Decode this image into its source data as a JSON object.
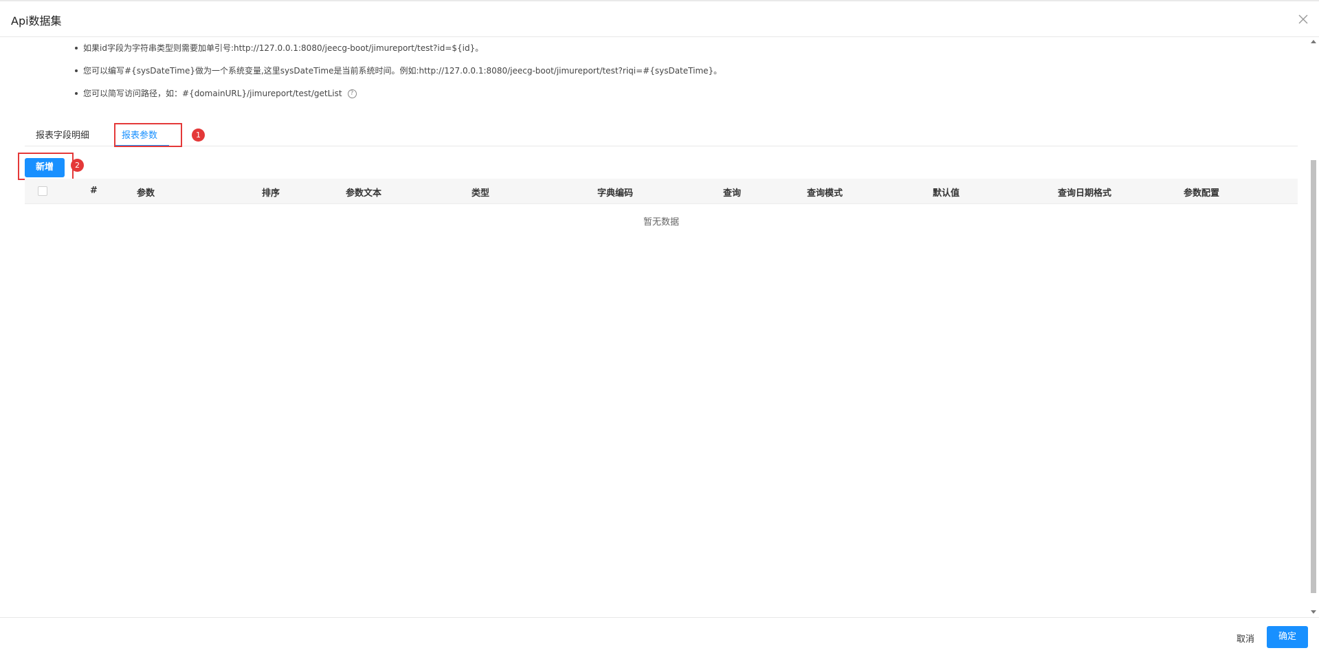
{
  "dialog": {
    "title": "Api数据集"
  },
  "tips": [
    "如果id字段为字符串类型则需要加单引号:http://127.0.0.1:8080/jeecg-boot/jimureport/test?id=${id}。",
    "您可以编写#{sysDateTime}做为一个系统变量,这里sysDateTime是当前系统时间。例如:http://127.0.0.1:8080/jeecg-boot/jimureport/test?riqi=#{sysDateTime}。",
    "您可以简写访问路径，如：#{domainURL}/jimureport/test/getList"
  ],
  "tabs": [
    {
      "label": "报表字段明细"
    },
    {
      "label": "报表参数"
    }
  ],
  "annotations": {
    "badge1": "1",
    "badge2": "2"
  },
  "toolbar": {
    "add_label": "新增"
  },
  "table": {
    "columns": [
      "#",
      "参数",
      "排序",
      "参数文本",
      "类型",
      "字典编码",
      "查询",
      "查询模式",
      "默认值",
      "查询日期格式",
      "参数配置"
    ],
    "empty_text": "暂无数据"
  },
  "footer": {
    "cancel_label": "取消",
    "ok_label": "确定"
  },
  "colors": {
    "primary": "#1890ff",
    "highlight": "#e43838"
  }
}
